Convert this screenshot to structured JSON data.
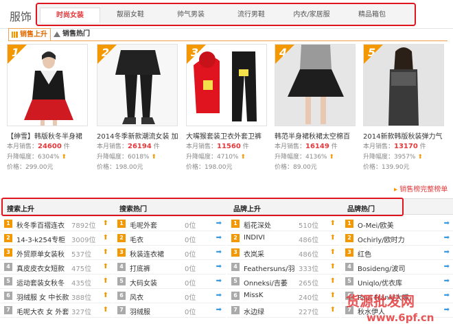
{
  "category_title": "服饰",
  "tabs": [
    "时尚女装",
    "靓丽女鞋",
    "帅气男装",
    "流行男鞋",
    "内衣/家居服",
    "精品箱包"
  ],
  "subtabs": {
    "rising": "销售上升",
    "hot": "销售热门"
  },
  "labels": {
    "monthly": "本月销售：",
    "unit": "件",
    "change": "升降幅度：",
    "price": "价格："
  },
  "products": [
    {
      "rank": "1",
      "title": "【绅雪】韩版秋冬半身裙",
      "sales": "24600",
      "change": "6304%",
      "price": "299.00元"
    },
    {
      "rank": "2",
      "title": "2014冬季新款潮流女装 加",
      "sales": "26194",
      "change": "6018%",
      "price": "198.00元"
    },
    {
      "rank": "3",
      "title": "大嘴猴套装卫衣外套卫裤",
      "sales": "11560",
      "change": "4710%",
      "price": "198.00元"
    },
    {
      "rank": "4",
      "title": "韩范半身裙秋裙太空棉百",
      "sales": "16149",
      "change": "4136%",
      "price": "89.00元"
    },
    {
      "rank": "5",
      "title": "2014新款韩版秋装弹力气",
      "sales": "13170",
      "change": "3957%",
      "price": "139.90元"
    }
  ],
  "more_link": "销售榜完整榜单",
  "sections": [
    "搜索上升",
    "搜索热门",
    "品牌上升",
    "品牌热门"
  ],
  "lists": {
    "search_rising": [
      {
        "n": "1",
        "name": "秋冬季百褶连衣",
        "count": "7892位",
        "dir": "up"
      },
      {
        "n": "2",
        "name": "14-3-k254专柜",
        "count": "3009位",
        "dir": "up"
      },
      {
        "n": "3",
        "name": "外贸原单女装秋",
        "count": "537位",
        "dir": "up"
      },
      {
        "n": "4",
        "name": "真皮皮衣女短款",
        "count": "475位",
        "dir": "up"
      },
      {
        "n": "5",
        "name": "运动套装女秋冬",
        "count": "435位",
        "dir": "up"
      },
      {
        "n": "6",
        "name": "羽绒服 女 中长款",
        "count": "388位",
        "dir": "up"
      },
      {
        "n": "7",
        "name": "毛呢大衣 女 外套",
        "count": "327位",
        "dir": "up"
      }
    ],
    "search_hot": [
      {
        "n": "1",
        "name": "毛呢外套",
        "count": "0位",
        "dir": "flat"
      },
      {
        "n": "2",
        "name": "毛衣",
        "count": "0位",
        "dir": "flat"
      },
      {
        "n": "3",
        "name": "秋装连衣裙",
        "count": "0位",
        "dir": "flat"
      },
      {
        "n": "4",
        "name": "打底裤",
        "count": "0位",
        "dir": "flat"
      },
      {
        "n": "5",
        "name": "大码女装",
        "count": "0位",
        "dir": "flat"
      },
      {
        "n": "6",
        "name": "风衣",
        "count": "0位",
        "dir": "flat"
      },
      {
        "n": "7",
        "name": "羽绒服",
        "count": "0位",
        "dir": "flat"
      }
    ],
    "brand_rising": [
      {
        "n": "1",
        "name": "稻花深处",
        "count": "510位",
        "dir": "up"
      },
      {
        "n": "2",
        "name": "INDIVI",
        "count": "486位",
        "dir": "up"
      },
      {
        "n": "3",
        "name": "衣岚采",
        "count": "486位",
        "dir": "up"
      },
      {
        "n": "4",
        "name": "Feathersuns/羽",
        "count": "333位",
        "dir": "up"
      },
      {
        "n": "5",
        "name": "Onneksi/吉萎",
        "count": "265位",
        "dir": "up"
      },
      {
        "n": "6",
        "name": "MissK",
        "count": "240位",
        "dir": "up"
      },
      {
        "n": "7",
        "name": "水边绿",
        "count": "227位",
        "dir": "up"
      }
    ],
    "brand_hot": [
      {
        "n": "1",
        "name": "O-Mei/欧美",
        "count": "",
        "dir": "flat"
      },
      {
        "n": "2",
        "name": "Ochirly/欧时力",
        "count": "",
        "dir": "flat"
      },
      {
        "n": "3",
        "name": "红色",
        "count": "",
        "dir": "flat"
      },
      {
        "n": "4",
        "name": "Bosideng/波司",
        "count": "",
        "dir": "flat"
      },
      {
        "n": "5",
        "name": "Uniqlo/优衣库",
        "count": "",
        "dir": "flat"
      },
      {
        "n": "6",
        "name": "Paul Frank/大嘴",
        "count": "",
        "dir": "flat"
      },
      {
        "n": "7",
        "name": "秋水伊人",
        "count": "",
        "dir": "flat"
      }
    ]
  },
  "watermark": {
    "line1": "货源批发网",
    "line2": "www.6pf.cn"
  },
  "colors": {
    "accent": "#f39800",
    "red": "#e4393c",
    "highlight_box": "#e0141e"
  }
}
